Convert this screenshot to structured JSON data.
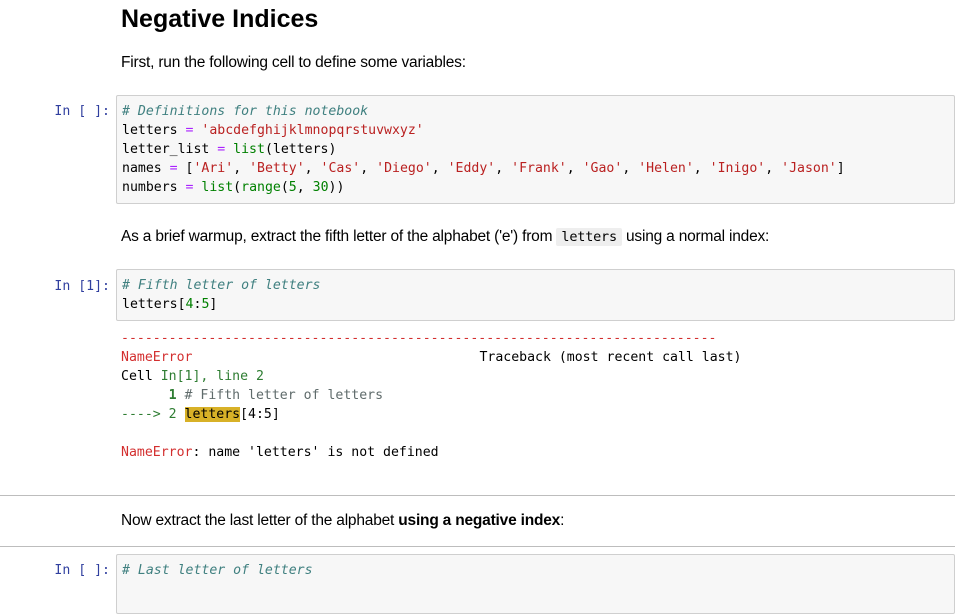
{
  "heading": "Negative Indices",
  "intro_text": "First, run the following cell to define some variables:",
  "cell1": {
    "prompt": "In [ ]:",
    "line1_comment": "# Definitions for this notebook",
    "line2_var": "letters",
    "line2_op": " = ",
    "line2_str": "'abcdefghijklmnopqrstuvwxyz'",
    "line3_var": "letter_list",
    "line3_op": " = ",
    "line3_fn": "list",
    "line3_rest": "(letters)",
    "line4_var": "names",
    "line4_op": " = ",
    "line4_open": "[",
    "names": [
      "'Ari'",
      "'Betty'",
      "'Cas'",
      "'Diego'",
      "'Eddy'",
      "'Frank'",
      "'Gao'",
      "'Helen'",
      "'Inigo'",
      "'Jason'"
    ],
    "line4_close": "]",
    "line5_var": "numbers",
    "line5_op": " = ",
    "line5_fn1": "list",
    "line5_p1": "(",
    "line5_fn2": "range",
    "line5_p2": "(",
    "line5_n1": "5",
    "line5_comma": ", ",
    "line5_n2": "30",
    "line5_close": "))"
  },
  "warmup_text_before": "As a brief warmup, extract the fifth letter of the alphabet ('e') from ",
  "warmup_code": "letters",
  "warmup_text_after": " using a normal index:",
  "cell2": {
    "prompt": "In [1]:",
    "line1_comment": "# Fifth letter of letters",
    "line2_var": "letters",
    "line2_open": "[",
    "line2_n1": "4",
    "line2_colon": ":",
    "line2_n2": "5",
    "line2_close": "]"
  },
  "traceback": {
    "dashes": "---------------------------------------------------------------------------",
    "error_name": "NameError",
    "traceback_label": "Traceback (most recent call last)",
    "cell_label": "Cell ",
    "cell_ref": "In[1], line 2",
    "line1_num": "      1 ",
    "line1_code": "# Fifth letter of letters",
    "arrow": "----> 2 ",
    "line2_hl": "letters",
    "line2_rest": "[4:5]",
    "final_name": "NameError",
    "final_msg": ": name 'letters' is not defined"
  },
  "negative_text_before": "Now extract the last letter of the alphabet ",
  "negative_text_bold": "using a negative index",
  "negative_text_after": ":",
  "cell3": {
    "prompt": "In [ ]:",
    "line1_comment": "# Last letter of letters"
  }
}
